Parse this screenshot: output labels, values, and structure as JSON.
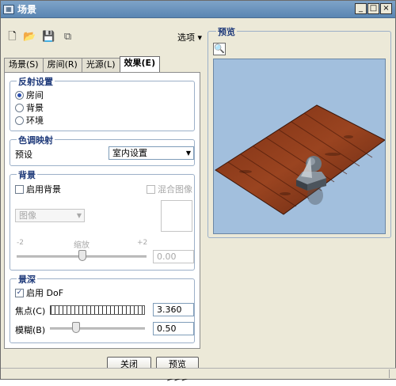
{
  "window": {
    "title": "场景"
  },
  "toolbar": {
    "options_label": "选项 ▾"
  },
  "tabs": [
    {
      "label": "场景(S)"
    },
    {
      "label": "房间(R)"
    },
    {
      "label": "光源(L)"
    },
    {
      "label": "效果(E)"
    }
  ],
  "reflection": {
    "title": "反射设置",
    "options": [
      "房间",
      "背景",
      "环境"
    ],
    "selected": "房间"
  },
  "tone_mapping": {
    "title": "色调映射",
    "preset_label": "预设",
    "preset_value": "室内设置"
  },
  "background": {
    "title": "背景",
    "enable_label": "启用背景",
    "blend_label": "混合图像",
    "image_select": "图像",
    "scale_min": "-2",
    "scale_label": "缩放",
    "scale_max": "+2",
    "scale_value": "0.00"
  },
  "dof": {
    "title": "景深",
    "enable_label": "启用 DoF",
    "enabled": true,
    "focus_label": "焦点(C)",
    "focus_value": "3.360",
    "blur_label": "模糊(B)",
    "blur_value": "0.50"
  },
  "buttons": {
    "close": "关闭",
    "preview": "预览 >>>"
  },
  "preview": {
    "title": "预览"
  }
}
